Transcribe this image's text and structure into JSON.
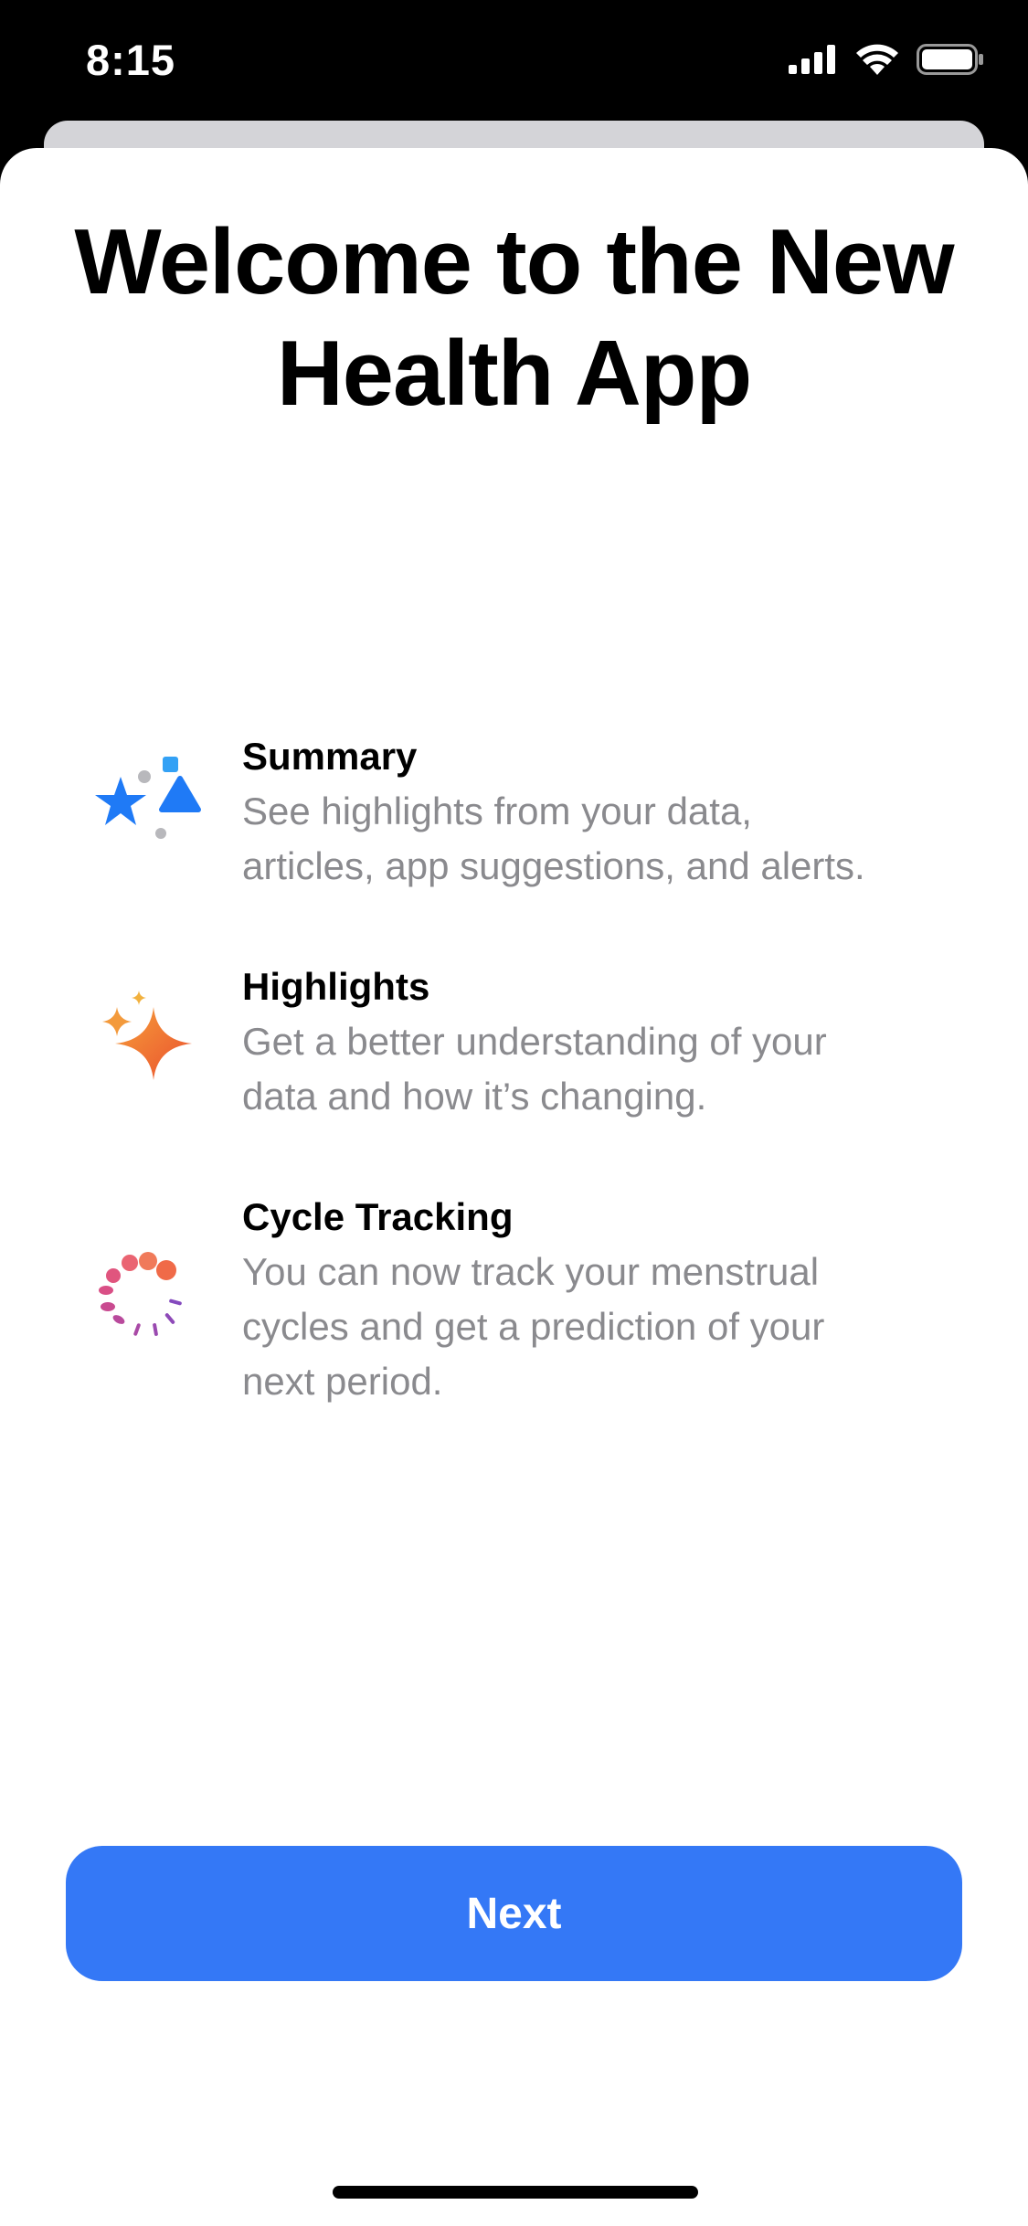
{
  "status_bar": {
    "time": "8:15",
    "icons": [
      "cellular-signal-icon",
      "wifi-icon",
      "battery-icon"
    ]
  },
  "title": {
    "line1": "Welcome to the New",
    "line2": "Health App"
  },
  "features": [
    {
      "icon": "summary-icon",
      "title": "Summary",
      "desc_lines": [
        "See highlights from your data,",
        "articles, app suggestions, and alerts."
      ]
    },
    {
      "icon": "highlights-sparkle-icon",
      "title": "Highlights",
      "desc_lines": [
        "Get a better understanding of your",
        "data and how it’s changing."
      ]
    },
    {
      "icon": "cycle-tracking-icon",
      "title": "Cycle Tracking",
      "desc_lines": [
        "You can now track your menstrual",
        "cycles and get a prediction of your",
        "next period."
      ]
    }
  ],
  "next_button": {
    "label": "Next"
  },
  "colors": {
    "accent": "#3478f6",
    "secondary_text": "#8a8a8e",
    "summary_blue": "#1f7af6",
    "highlights_orange": "#f0633a",
    "cycle_pink": "#e0507a"
  }
}
